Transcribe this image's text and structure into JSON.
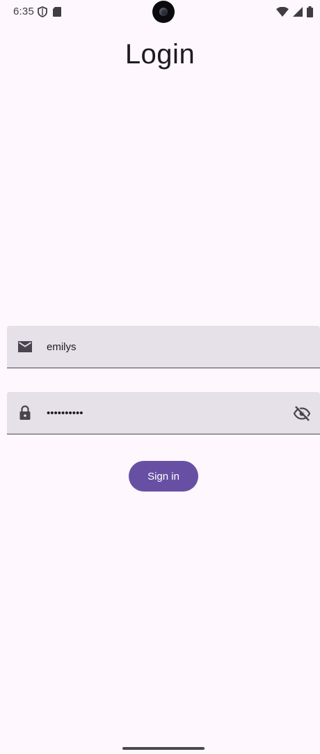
{
  "status_bar": {
    "time": "6:35",
    "left_icons": [
      "shield-icon",
      "sd-card-icon"
    ],
    "right_icons": [
      "wifi-icon",
      "cellular-signal-icon",
      "battery-icon"
    ]
  },
  "page": {
    "title": "Login"
  },
  "form": {
    "email": {
      "icon": "mail-icon",
      "value": "emilys"
    },
    "password": {
      "icon": "lock-icon",
      "value": "••••••••••",
      "toggle_icon": "visibility-off-icon"
    },
    "submit_label": "Sign in"
  },
  "colors": {
    "background": "#fef7fd",
    "field_fill": "#e6e0e9",
    "primary": "#6750a4",
    "on_primary": "#ffffff",
    "text": "#1d1b20"
  }
}
